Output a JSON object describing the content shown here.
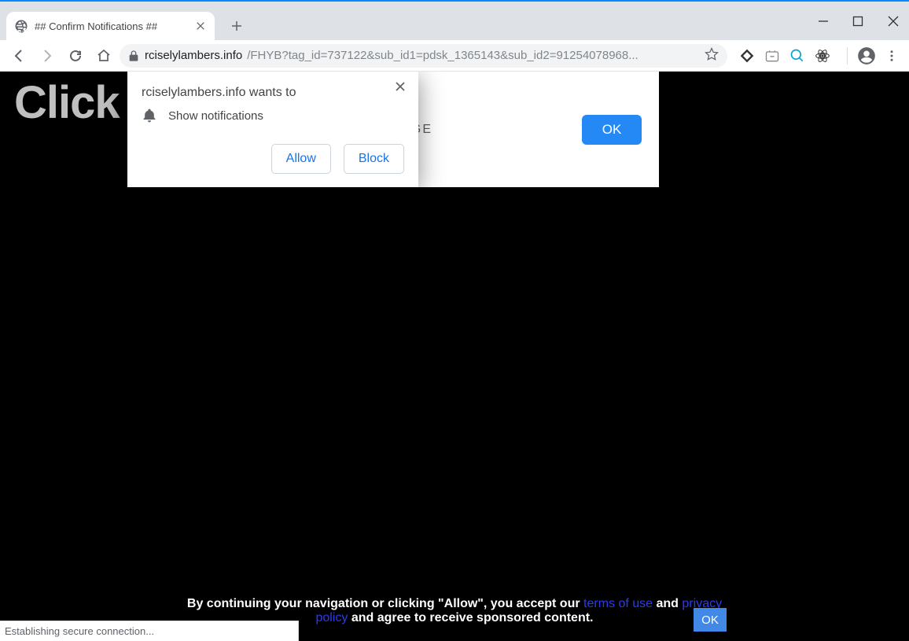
{
  "window": {
    "tab_title": "## Confirm Notifications ##"
  },
  "addressbar": {
    "host": "rciselylambers.info",
    "path": "/FHYB?tag_id=737122&sub_id1=pdsk_1365143&sub_id2=91254078968..."
  },
  "page": {
    "headline": "Click               at you are",
    "panel_fragment_text": "PAGE",
    "panel_ok_label": "OK"
  },
  "prompt": {
    "origin_label": "rciselylambers.info wants to",
    "permission_label": "Show notifications",
    "allow_label": "Allow",
    "block_label": "Block"
  },
  "consent": {
    "line1_pre": "By continuing your navigation or clicking \"Allow\", you accept our ",
    "terms_link": "terms of use",
    "line1_mid": " and ",
    "privacy_link1": "privacy",
    "privacy_link2": "policy",
    "line2_post": " and agree to receive sponsored content.",
    "ok_label": "OK"
  },
  "status": {
    "text": "Establishing secure connection..."
  }
}
